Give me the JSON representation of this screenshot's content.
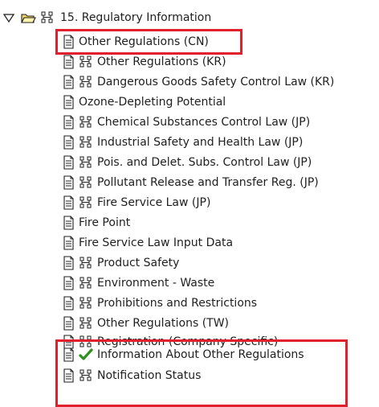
{
  "tree": {
    "root": {
      "label": "15. Regulatory Information",
      "expander_icon": "triangle-down-icon",
      "folder_icon": "open-folder-icon",
      "structure_icon": "hierarchy-icon"
    },
    "items": [
      {
        "label": "Other Regulations (CN)",
        "icons": [
          "document-icon"
        ]
      },
      {
        "label": "Other Regulations (KR)",
        "icons": [
          "document-icon",
          "hierarchy-icon"
        ]
      },
      {
        "label": "Dangerous Goods Safety Control Law (KR)",
        "icons": [
          "document-icon",
          "hierarchy-icon"
        ]
      },
      {
        "label": "Ozone-Depleting Potential",
        "icons": [
          "document-icon"
        ]
      },
      {
        "label": "Chemical Substances Control Law (JP)",
        "icons": [
          "document-icon",
          "hierarchy-icon"
        ]
      },
      {
        "label": "Industrial Safety and Health Law (JP)",
        "icons": [
          "document-icon",
          "hierarchy-icon"
        ]
      },
      {
        "label": "Pois. and Delet. Subs. Control Law (JP)",
        "icons": [
          "document-icon",
          "hierarchy-icon"
        ]
      },
      {
        "label": "Pollutant Release and Transfer Reg. (JP)",
        "icons": [
          "document-icon",
          "hierarchy-icon"
        ]
      },
      {
        "label": "Fire Service Law (JP)",
        "icons": [
          "document-icon",
          "hierarchy-icon"
        ]
      },
      {
        "label": "Fire Point",
        "icons": [
          "document-icon"
        ]
      },
      {
        "label": "Fire Service Law Input Data",
        "icons": [
          "document-icon"
        ]
      },
      {
        "label": "Product Safety",
        "icons": [
          "document-icon",
          "hierarchy-icon"
        ]
      },
      {
        "label": "Environment - Waste",
        "icons": [
          "document-icon",
          "hierarchy-icon"
        ]
      },
      {
        "label": "Prohibitions and Restrictions",
        "icons": [
          "document-icon",
          "hierarchy-icon"
        ]
      },
      {
        "label": "Other Regulations (TW)",
        "icons": [
          "document-icon",
          "hierarchy-icon"
        ]
      },
      {
        "label": "Registration (Company Specific)",
        "icons": [
          "document-icon",
          "hierarchy-icon"
        ]
      },
      {
        "label": "Information About Other Regulations",
        "icons": [
          "document-icon",
          "green-check-icon"
        ]
      },
      {
        "label": "Notification Status",
        "icons": [
          "document-icon",
          "hierarchy-icon"
        ]
      }
    ],
    "highlight_color": "#e0202c",
    "check_color": "#2f8f1f",
    "folder_color": "#d7b531"
  }
}
